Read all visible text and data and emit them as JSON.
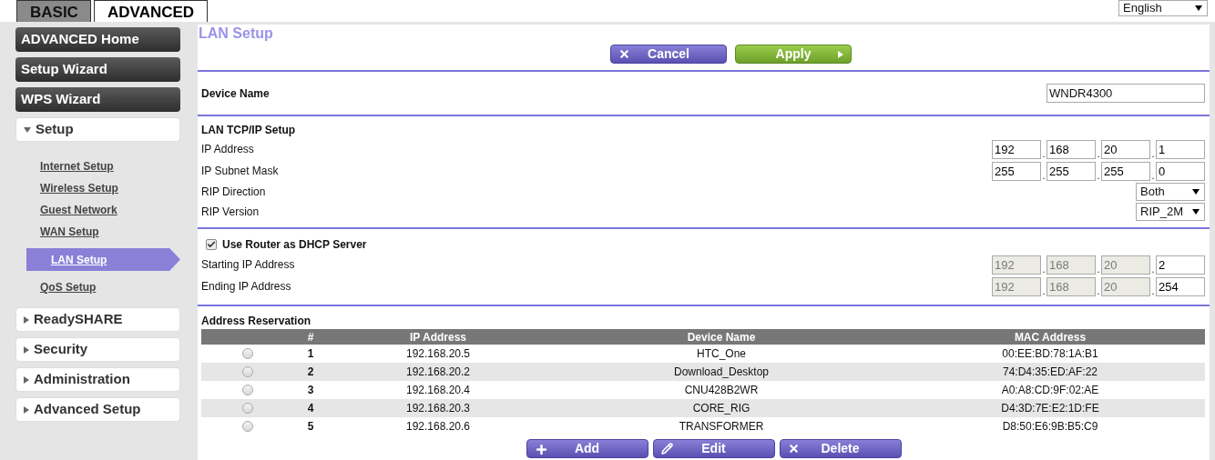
{
  "tabs": [
    {
      "label": "BASIC",
      "selected": false
    },
    {
      "label": "ADVANCED",
      "selected": true
    }
  ],
  "language": {
    "value": "English"
  },
  "sidebar": {
    "items": [
      {
        "kind": "button",
        "label": "ADVANCED Home"
      },
      {
        "kind": "button",
        "label": "Setup Wizard"
      },
      {
        "kind": "button",
        "label": "WPS Wizard"
      },
      {
        "kind": "section",
        "label": "Setup",
        "expanded": true,
        "children": [
          {
            "label": "Internet Setup",
            "selected": false
          },
          {
            "label": "Wireless Setup",
            "selected": false
          },
          {
            "label": "Guest Network",
            "selected": false
          },
          {
            "label": "WAN Setup",
            "selected": false
          },
          {
            "label": "LAN Setup",
            "selected": true
          },
          {
            "label": "QoS Setup",
            "selected": false
          }
        ]
      },
      {
        "kind": "section",
        "label": "ReadySHARE",
        "expanded": false
      },
      {
        "kind": "section",
        "label": "Security",
        "expanded": false
      },
      {
        "kind": "section",
        "label": "Administration",
        "expanded": false
      },
      {
        "kind": "section",
        "label": "Advanced Setup",
        "expanded": false
      }
    ]
  },
  "page": {
    "title": "LAN Setup",
    "buttons": [
      {
        "kind": "cancel",
        "label": "Cancel"
      },
      {
        "kind": "apply",
        "label": "Apply"
      }
    ]
  },
  "device_name": {
    "label": "Device Name",
    "value": "WNDR4300"
  },
  "lan_tcpip": {
    "heading": "LAN TCP/IP Setup",
    "fields": [
      {
        "kind": "octets",
        "label": "IP Address",
        "separator": ".",
        "octets": [
          {
            "value": "192",
            "disabled": false
          },
          {
            "value": "168",
            "disabled": false
          },
          {
            "value": "20",
            "disabled": false
          },
          {
            "value": "1",
            "disabled": false
          }
        ]
      },
      {
        "kind": "octets",
        "label": "IP Subnet Mask",
        "separator": ".",
        "octets": [
          {
            "value": "255",
            "disabled": false
          },
          {
            "value": "255",
            "disabled": false
          },
          {
            "value": "255",
            "disabled": false
          },
          {
            "value": "0",
            "disabled": false
          }
        ]
      },
      {
        "kind": "select",
        "label": "RIP Direction",
        "value": "Both"
      },
      {
        "kind": "select",
        "label": "RIP Version",
        "value": "RIP_2M"
      }
    ]
  },
  "dhcp": {
    "label": "Use Router as DHCP Server",
    "checked": true,
    "fields": [
      {
        "kind": "octets",
        "label": "Starting IP Address",
        "separator": ".",
        "octets": [
          {
            "value": "192",
            "disabled": true
          },
          {
            "value": "168",
            "disabled": true
          },
          {
            "value": "20",
            "disabled": true
          },
          {
            "value": "2",
            "disabled": false
          }
        ]
      },
      {
        "kind": "octets",
        "label": "Ending IP Address",
        "separator": ".",
        "octets": [
          {
            "value": "192",
            "disabled": true
          },
          {
            "value": "168",
            "disabled": true
          },
          {
            "value": "20",
            "disabled": true
          },
          {
            "value": "254",
            "disabled": false
          }
        ]
      }
    ]
  },
  "reservation": {
    "heading": "Address Reservation",
    "columns": [
      "#",
      "IP Address",
      "Device Name",
      "MAC Address"
    ],
    "rows": [
      {
        "selected": false,
        "number": "1",
        "ip": "192.168.20.5",
        "device": "HTC_One",
        "mac": "00:EE:BD:78:1A:B1"
      },
      {
        "selected": false,
        "number": "2",
        "ip": "192.168.20.2",
        "device": "Download_Desktop",
        "mac": "74:D4:35:ED:AF:22"
      },
      {
        "selected": false,
        "number": "3",
        "ip": "192.168.20.4",
        "device": "CNU428B2WR",
        "mac": "A0:A8:CD:9F:02:AE"
      },
      {
        "selected": false,
        "number": "4",
        "ip": "192.168.20.3",
        "device": "CORE_RIG",
        "mac": "D4:3D:7E:E2:1D:FE"
      },
      {
        "selected": false,
        "number": "5",
        "ip": "192.168.20.6",
        "device": "TRANSFORMER",
        "mac": "D8:50:E6:9B:B5:C9"
      }
    ],
    "buttons": [
      {
        "kind": "add",
        "label": "Add"
      },
      {
        "kind": "edit",
        "label": "Edit"
      },
      {
        "kind": "delete",
        "label": "Delete"
      }
    ]
  }
}
